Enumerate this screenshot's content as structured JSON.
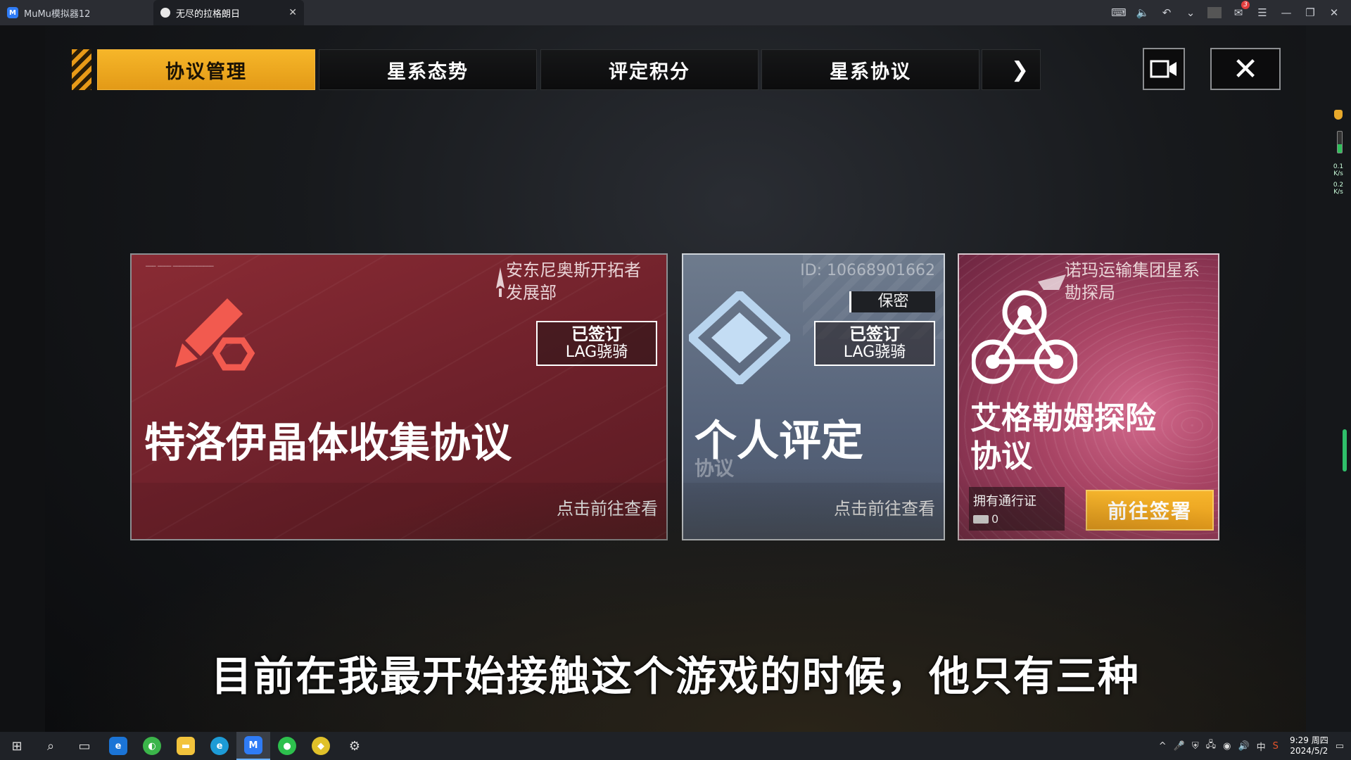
{
  "emulator": {
    "home_tab": "MuMu模拟器12",
    "game_tab": "无尽的拉格朗日",
    "notification_count": "3"
  },
  "nav": {
    "tabs": [
      "协议管理",
      "星系态势",
      "评定积分",
      "星系协议"
    ],
    "active_tab": "协议管理",
    "more": "❯",
    "close": "✕"
  },
  "cards": {
    "crystal": {
      "org": "安东尼奥斯开拓者发展部",
      "signed_line1": "已签订",
      "signed_line2": "LAG骁骑",
      "title": "特洛伊晶体收集协议",
      "action": "点击前往查看"
    },
    "personal": {
      "id": "ID: 10668901662",
      "secret": "保密",
      "signed_line1": "已签订",
      "signed_line2": "LAG骁骑",
      "title": "个人评定",
      "subtitle": "协议",
      "action": "点击前往查看"
    },
    "expedition": {
      "org": "诺玛运输集团星系勘探局",
      "title": "艾格勒姆探险协议",
      "pass_label": "拥有通行证",
      "pass_count": "0",
      "button": "前往签署"
    }
  },
  "subtitle": "目前在我最开始接触这个游戏的时候，他只有三种",
  "side_stats": {
    "up": "0.1",
    "down": "0.2",
    "unit": "K/s"
  },
  "taskbar": {
    "ime": "中",
    "time": "9:29 周四",
    "date": "2024/5/2"
  },
  "colors": {
    "accent": "#f0a820",
    "card_red": "#7a2530",
    "card_blue": "#5e6b80",
    "card_pink": "#b34a6b"
  }
}
